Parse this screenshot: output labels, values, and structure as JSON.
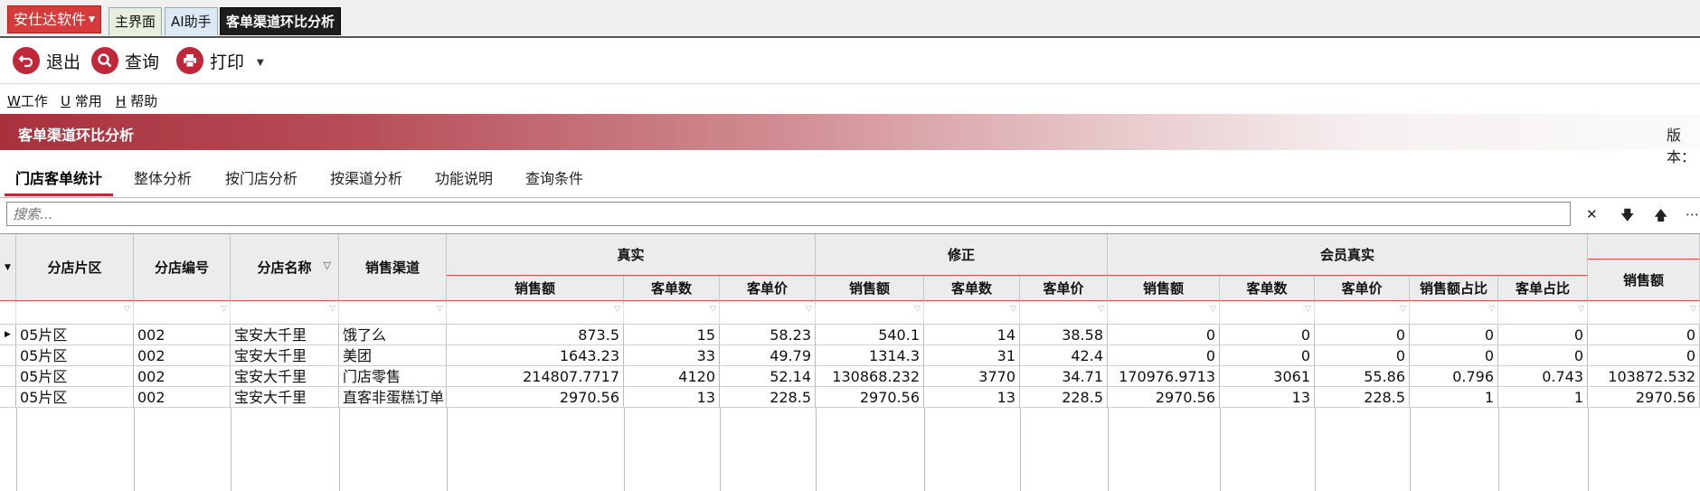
{
  "app": {
    "brand": "安仕达软件",
    "tabs": [
      "主界面",
      "AI助手",
      "客单渠道环比分析"
    ]
  },
  "toolbar": {
    "exit": "退出",
    "query": "查询",
    "print": "打印"
  },
  "menu": [
    {
      "key": "W",
      "label": "工作"
    },
    {
      "key": "U",
      "label": "常用"
    },
    {
      "key": "H",
      "label": "帮助"
    }
  ],
  "banner": {
    "title": "客单渠道环比分析",
    "version": "版本："
  },
  "subtabs": [
    "门店客单统计",
    "整体分析",
    "按门店分析",
    "按渠道分析",
    "功能说明",
    "查询条件"
  ],
  "search": {
    "placeholder": "搜索..."
  },
  "grid": {
    "fixed_headers": [
      "分店片区",
      "分店编号",
      "分店名称",
      "销售渠道"
    ],
    "groups": [
      "真实",
      "修正",
      "会员真实"
    ],
    "sub_headers": [
      "销售额",
      "客单数",
      "客单价",
      "销售额",
      "客单数",
      "客单价",
      "销售额",
      "客单数",
      "客单价",
      "销售额占比",
      "客单占比",
      "销售额"
    ],
    "rows": [
      [
        "05片区",
        "002",
        "宝安大千里",
        "饿了么",
        "873.5",
        "15",
        "58.23",
        "540.1",
        "14",
        "38.58",
        "0",
        "0",
        "0",
        "0",
        "0",
        "0"
      ],
      [
        "05片区",
        "002",
        "宝安大千里",
        "美团",
        "1643.23",
        "33",
        "49.79",
        "1314.3",
        "31",
        "42.4",
        "0",
        "0",
        "0",
        "0",
        "0",
        "0"
      ],
      [
        "05片区",
        "002",
        "宝安大千里",
        "门店零售",
        "214807.7717",
        "4120",
        "52.14",
        "130868.232",
        "3770",
        "34.71",
        "170976.9713",
        "3061",
        "55.86",
        "0.796",
        "0.743",
        "103872.532"
      ],
      [
        "05片区",
        "002",
        "宝安大千里",
        "直客非蛋糕订单",
        "2970.56",
        "13",
        "228.5",
        "2970.56",
        "13",
        "228.5",
        "2970.56",
        "13",
        "228.5",
        "1",
        "1",
        "2970.56"
      ]
    ]
  }
}
